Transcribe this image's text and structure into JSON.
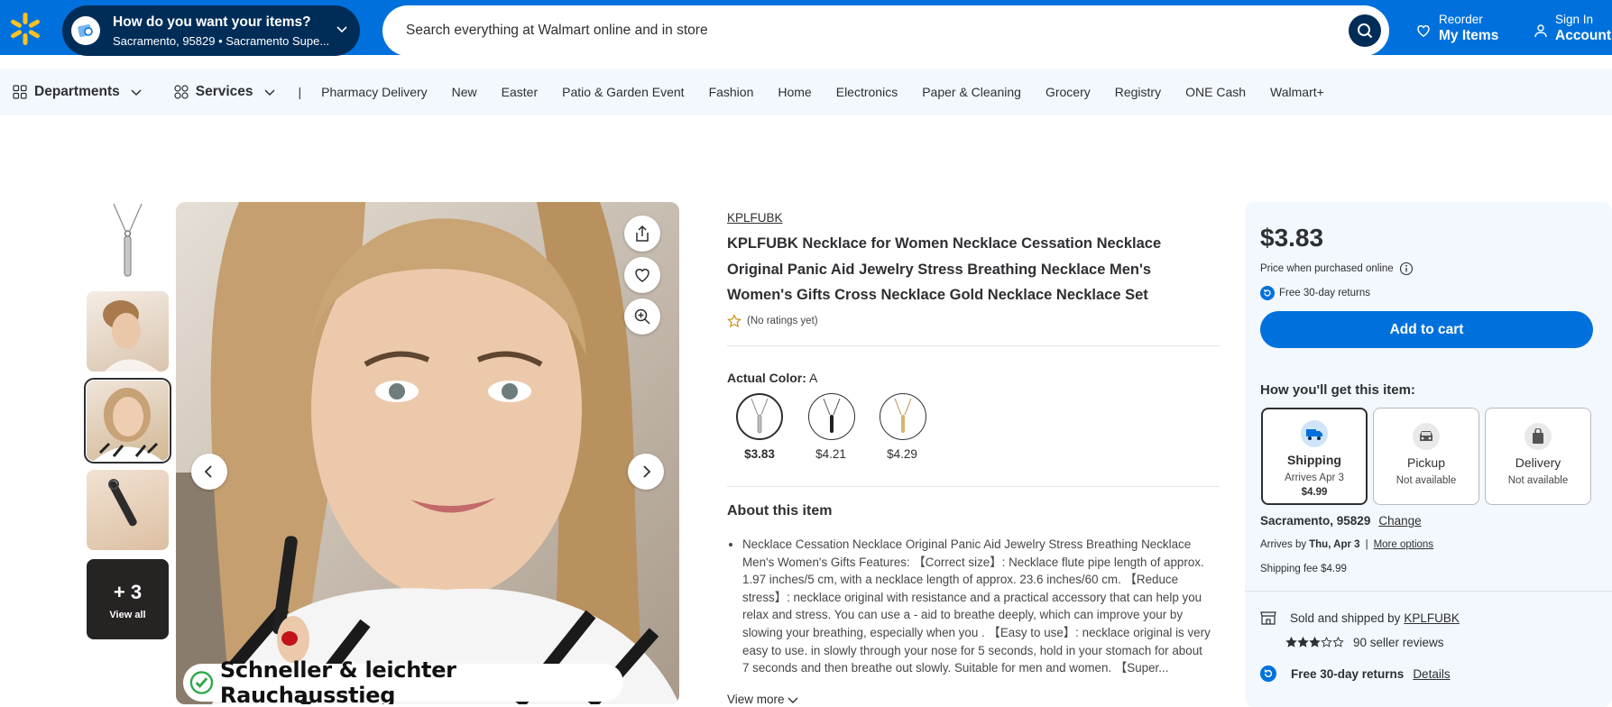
{
  "header": {
    "location_title": "How do you want your items?",
    "location_zip": "Sacramento, 95829",
    "location_store": "Sacramento Supe...",
    "search_placeholder": "Search everything at Walmart online and in store",
    "reorder_small": "Reorder",
    "reorder_large": "My Items",
    "account_small": "Sign In",
    "account_large": "Account",
    "brand_color": "#0071dc",
    "brand_dark": "#002d58",
    "spark_color": "#ffc220"
  },
  "nav": {
    "departments": "Departments",
    "services": "Services",
    "divider": "|",
    "items": [
      "Pharmacy Delivery",
      "New",
      "Easter",
      "Patio & Garden Event",
      "Fashion",
      "Home",
      "Electronics",
      "Paper & Cleaning",
      "Grocery",
      "Registry",
      "ONE Cash",
      "Walmart+"
    ]
  },
  "gallery": {
    "more_count": "+ 3",
    "view_all": "View all",
    "banner_text": "Schneller & leichter Rauchausstieg"
  },
  "product": {
    "brand": "KPLFUBK",
    "title": "KPLFUBK Necklace for Women Necklace Cessation Necklace Original Panic Aid Jewelry Stress Breathing Necklace Men's Women's Gifts Cross Necklace Gold Necklace Necklace Set",
    "rating_text": "(No ratings yet)",
    "color_label": "Actual Color:",
    "color_value": "A",
    "swatches": [
      {
        "price": "$3.83",
        "selected": true
      },
      {
        "price": "$4.21",
        "selected": false
      },
      {
        "price": "$4.29",
        "selected": false
      }
    ],
    "about_title": "About this item",
    "about_text": "Necklace Cessation Necklace Original Panic Aid Jewelry Stress Breathing Necklace Men's Women's Gifts Features: 【Correct size】: Necklace flute pipe length of approx. 1.97 inches/5 cm, with a necklace length of approx. 23.6 inches/60 cm. 【Reduce stress】: necklace original with resistance and a practical accessory that can help you relax and stress. You can use a - aid to breathe deeply, which can improve your by slowing your breathing, especially when you . 【Easy to use】: necklace original is very easy to use. in slowly through your nose for 5 seconds, hold in your stomach for about 7 seconds and then breathe out slowly. Suitable for men and women. 【Super...",
    "view_more": "View more"
  },
  "buybox": {
    "price": "$3.83",
    "price_note": "Price when purchased online",
    "free_returns": "Free 30-day returns",
    "add_to_cart": "Add to cart",
    "how_title": "How you'll get this item:",
    "options": [
      {
        "name": "Shipping",
        "sub": "Arrives Apr 3",
        "fee": "$4.99",
        "icon": "truck-icon",
        "selected": true
      },
      {
        "name": "Pickup",
        "sub": "Not available",
        "fee": "",
        "icon": "car-icon",
        "selected": false
      },
      {
        "name": "Delivery",
        "sub": "Not available",
        "fee": "",
        "icon": "delivery-bag-icon",
        "selected": false
      }
    ],
    "zip": "Sacramento, 95829",
    "change": "Change",
    "arrives_prefix": "Arrives by",
    "arrives_date": "Thu, Apr 3",
    "more_options": "More options",
    "ship_fee": "Shipping fee $4.99",
    "sold_prefix": "Sold and shipped by",
    "seller": "KPLFUBK",
    "seller_rating": 3,
    "seller_reviews": "90 seller reviews",
    "free_returns_2": "Free 30-day returns",
    "details": "Details"
  }
}
